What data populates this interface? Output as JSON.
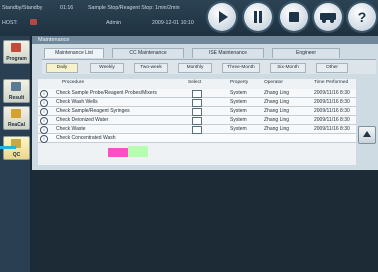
{
  "status": {
    "mode": "Standby/Standby",
    "time_remaining": "01:16",
    "sample_status": "Sample Stop/Reagent Stop: 1min/2min",
    "host_label": "HOST:",
    "user": "Admin",
    "datetime": "2009-12-01 10:10"
  },
  "toolbar": {
    "buttons": [
      {
        "name": "start-button",
        "icon": "play-icon"
      },
      {
        "name": "pause-button",
        "icon": "pause-icon"
      },
      {
        "name": "stop-button",
        "icon": "stop-icon"
      },
      {
        "name": "transport-button",
        "icon": "truck-icon"
      },
      {
        "name": "help-button",
        "icon": "help-icon",
        "glyph": "?"
      }
    ]
  },
  "nav": {
    "items": [
      {
        "label": "Program",
        "icon": "program-icon",
        "color": "#c44b3b"
      },
      {
        "label": "Result",
        "icon": "result-icon",
        "color": "#5a7a96"
      },
      {
        "label": "ReaCal",
        "icon": "reagent-icon",
        "color": "#d5a230"
      },
      {
        "label": "QC",
        "icon": "qc-icon",
        "color": "#c9a646"
      }
    ]
  },
  "panel": {
    "title": "Maintenance",
    "main_tabs": [
      "Maintenance List",
      "CC Maintenance",
      "ISE Maintenance",
      "Engineer"
    ],
    "sub_tabs": [
      "Daily",
      "Weekly",
      "Two-week",
      "Monthly",
      "Three-Month",
      "Six-Month",
      "Other"
    ],
    "active_sub_tab": "Daily"
  },
  "table": {
    "columns": [
      "Procedure",
      "Select",
      "Property",
      "Operator",
      "Time Performed"
    ],
    "rows": [
      {
        "procedure": "Check Sample Probe/Reagent Probes/Mixers",
        "property": "System",
        "operator": "Zhang Ling",
        "time": "2009/11/16 8:30"
      },
      {
        "procedure": "Check Wash Wells",
        "property": "System",
        "operator": "Zhang Ling",
        "time": "2009/11/16 8:30"
      },
      {
        "procedure": "Check Sample/Reagent Syringes",
        "property": "System",
        "operator": "Zhang Ling",
        "time": "2009/11/16 8:30"
      },
      {
        "procedure": "Check Deionized Water",
        "property": "System",
        "operator": "Zhang Ling",
        "time": "2009/11/16 8:30"
      },
      {
        "procedure": "Check Waste",
        "property": "System",
        "operator": "Zhang Ling",
        "time": "2009/11/16 8:30"
      },
      {
        "procedure": "Check Concentrated Wash ",
        "property": "",
        "operator": "",
        "time": ""
      }
    ]
  }
}
